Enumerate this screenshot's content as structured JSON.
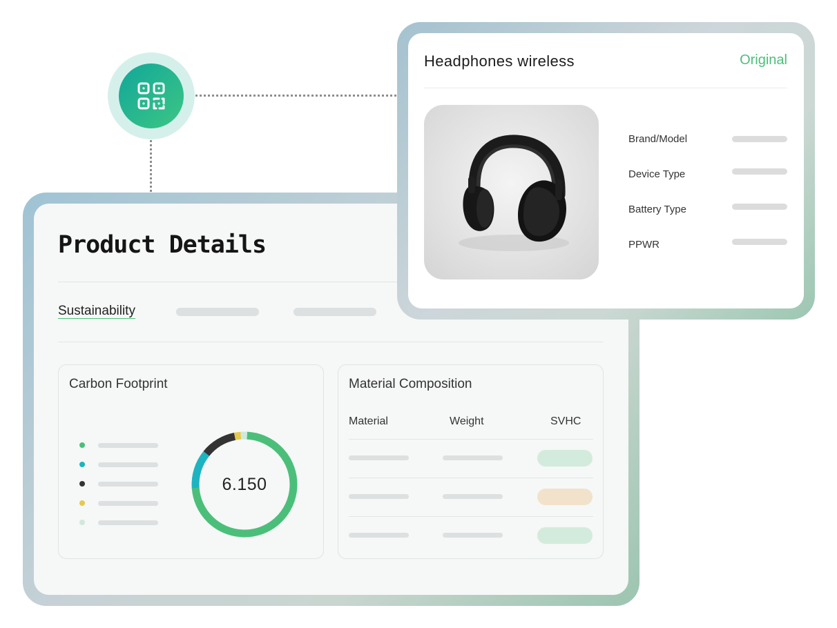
{
  "qr_badge": {
    "icon": "qr-code-icon"
  },
  "product_details": {
    "title": "Product Details",
    "tabs": [
      {
        "label": "Sustainability",
        "active": true
      },
      {
        "label": "",
        "placeholder": true
      },
      {
        "label": "",
        "placeholder": true
      }
    ],
    "carbon_footprint": {
      "title": "Carbon Footprint",
      "value": "6.150",
      "legend_colors": [
        "#4bbf7a",
        "#1eb3c0",
        "#333333",
        "#e5c94c",
        "#cfe9dc"
      ]
    },
    "material_composition": {
      "title": "Material Composition",
      "columns": [
        "Material",
        "Weight",
        "SVHC"
      ],
      "row_status_colors": [
        "#d3ebdc",
        "#f2e2cc",
        "#d3ebdc"
      ]
    }
  },
  "headphones_card": {
    "title": "Headphones wireless",
    "badge": "Original",
    "image_label": "headphones-image",
    "specs": [
      "Brand/Model",
      "Device Type",
      "Battery Type",
      "PPWR"
    ]
  },
  "colors": {
    "accent_green": "#4bbf7a",
    "accent_teal": "#1eb3c0",
    "dark": "#333333",
    "yellow": "#e5c94c",
    "pale_green": "#cfe9dc"
  },
  "chart_data": {
    "type": "pie",
    "title": "Carbon Footprint",
    "center_label": "6.150",
    "slices": [
      {
        "color": "#4bbf7a",
        "value": 73
      },
      {
        "color": "#1eb3c0",
        "value": 12
      },
      {
        "color": "#333333",
        "value": 11
      },
      {
        "color": "#e5c94c",
        "value": 2
      },
      {
        "color": "#cfe9dc",
        "value": 2
      }
    ]
  }
}
